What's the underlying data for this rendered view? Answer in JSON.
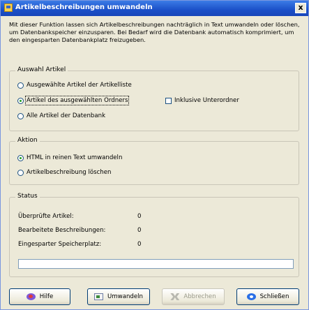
{
  "window": {
    "title": "Artikelbeschreibungen umwandeln",
    "close_glyph": "x"
  },
  "description": "Mit dieser Funktion lassen sich Artikelbeschreibungen nachträglich in Text umwandeln oder löschen, um Datenbankspeicher einzusparen. Bei Bedarf wird die Datenbank automatisch komprimiert, um den eingesparten Datenbankplatz freizugeben.",
  "auswahl": {
    "title": "Auswahl Artikel",
    "options": [
      {
        "label": "Ausgewählte Artikel der Artikelliste",
        "selected": false
      },
      {
        "label": "Artikel des ausgewählten Ordners",
        "selected": true
      },
      {
        "label": "Alle Artikel der Datenbank",
        "selected": false
      }
    ],
    "checkbox_label": "Inklusive Unterordner",
    "checkbox_checked": false
  },
  "aktion": {
    "title": "Aktion",
    "options": [
      {
        "label": "HTML in reinen Text umwandeln",
        "selected": true
      },
      {
        "label": "Artikelbeschreibung löschen",
        "selected": false
      }
    ]
  },
  "status": {
    "title": "Status",
    "rows": [
      {
        "label": "Überprüfte Artikel:",
        "value": "0"
      },
      {
        "label": "Bearbeitete Beschreibungen:",
        "value": "0"
      },
      {
        "label": "Eingesparter Speicherplatz:",
        "value": "0"
      }
    ],
    "progress": 0
  },
  "buttons": {
    "help": "Hilfe",
    "convert": "Umwandeln",
    "cancel": "Abbrechen",
    "close": "Schließen"
  }
}
